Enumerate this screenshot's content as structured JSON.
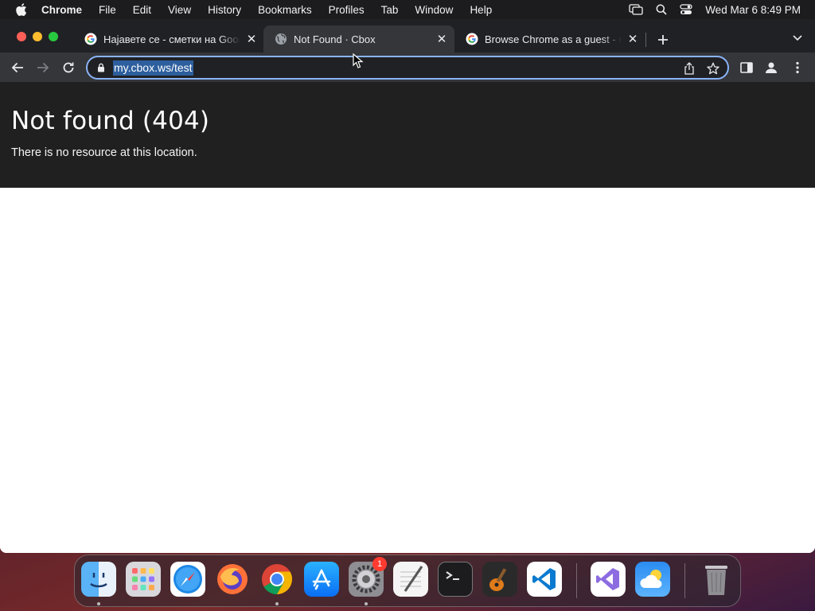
{
  "menubar": {
    "app_name": "Chrome",
    "items": [
      "File",
      "Edit",
      "View",
      "History",
      "Bookmarks",
      "Profiles",
      "Tab",
      "Window",
      "Help"
    ],
    "clock": "Wed Mar 6  8:49 PM"
  },
  "tabs": [
    {
      "title": "Најавете се - сметки на Google",
      "favicon": "google-icon",
      "active": false
    },
    {
      "title": "Not Found · Cbox",
      "favicon": "globe-icon",
      "active": true
    },
    {
      "title": "Browse Chrome as a guest - Co",
      "favicon": "google-icon",
      "active": false
    }
  ],
  "omnibox": {
    "url": "my.cbox.ws/test"
  },
  "page": {
    "title": "Not found (404)",
    "description": "There is no resource at this location."
  },
  "dock": {
    "items": [
      {
        "name": "finder",
        "running": true
      },
      {
        "name": "launchpad",
        "running": false
      },
      {
        "name": "safari",
        "running": false
      },
      {
        "name": "firefox",
        "running": false
      },
      {
        "name": "chrome",
        "running": true
      },
      {
        "name": "app-store",
        "running": false
      },
      {
        "name": "system-settings",
        "running": true,
        "badge": "1"
      },
      {
        "name": "textedit",
        "running": false
      },
      {
        "name": "terminal",
        "running": false
      },
      {
        "name": "garageband",
        "running": false
      },
      {
        "name": "vscode",
        "running": false
      },
      {
        "name": "visual-studio",
        "running": false
      },
      {
        "name": "weather",
        "running": false
      },
      {
        "name": "trash",
        "running": false
      }
    ]
  },
  "colors": {
    "page_header_bg": "#202020",
    "tabstrip_bg": "#202124",
    "toolbar_bg": "#35363a",
    "omnibox_focus": "#8ab4f8",
    "url_selection": "#2d5f9e"
  }
}
